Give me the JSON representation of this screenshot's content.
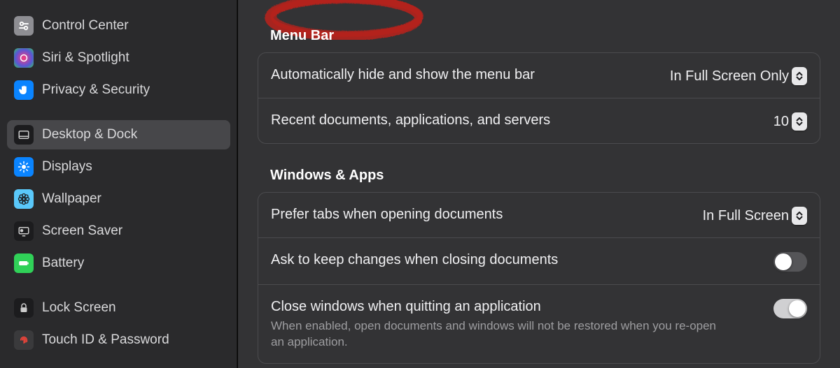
{
  "sidebar": {
    "items": [
      {
        "id": "control-center",
        "label": "Control Center"
      },
      {
        "id": "siri-spotlight",
        "label": "Siri & Spotlight"
      },
      {
        "id": "privacy-security",
        "label": "Privacy & Security"
      },
      {
        "id": "desktop-dock",
        "label": "Desktop & Dock"
      },
      {
        "id": "displays",
        "label": "Displays"
      },
      {
        "id": "wallpaper",
        "label": "Wallpaper"
      },
      {
        "id": "screen-saver",
        "label": "Screen Saver"
      },
      {
        "id": "battery",
        "label": "Battery"
      },
      {
        "id": "lock-screen",
        "label": "Lock Screen"
      },
      {
        "id": "touch-id",
        "label": "Touch ID & Password"
      }
    ],
    "selected_id": "desktop-dock"
  },
  "sections": {
    "menubar": {
      "title": "Menu Bar",
      "autohide": {
        "label": "Automatically hide and show the menu bar",
        "value": "In Full Screen Only"
      },
      "recent": {
        "label": "Recent documents, applications, and servers",
        "value": "10"
      }
    },
    "windows": {
      "title": "Windows & Apps",
      "tabs": {
        "label": "Prefer tabs when opening documents",
        "value": "In Full Screen"
      },
      "ask": {
        "label": "Ask to keep changes when closing documents",
        "value": false
      },
      "close": {
        "label": "Close windows when quitting an application",
        "desc": "When enabled, open documents and windows will not be restored when you re-open an application.",
        "value": true
      }
    }
  },
  "annotation": {
    "kind": "red-circle"
  }
}
